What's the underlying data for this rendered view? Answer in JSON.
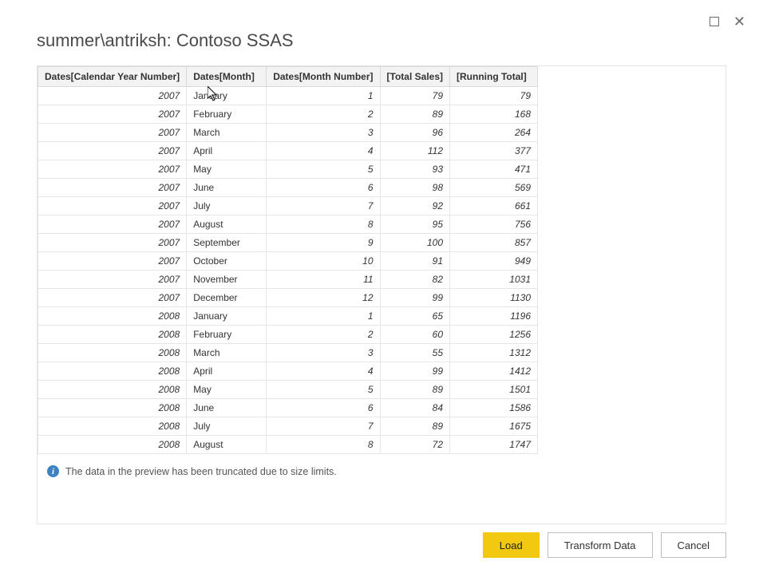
{
  "window": {
    "title": "summer\\antriksh: Contoso SSAS"
  },
  "table": {
    "headers": {
      "year": "Dates[Calendar Year Number]",
      "month": "Dates[Month]",
      "monthnum": "Dates[Month Number]",
      "total": "[Total Sales]",
      "running": "[Running Total]"
    },
    "rows": [
      {
        "year": "2007",
        "month": "January",
        "monthnum": "1",
        "total": "79",
        "running": "79"
      },
      {
        "year": "2007",
        "month": "February",
        "monthnum": "2",
        "total": "89",
        "running": "168"
      },
      {
        "year": "2007",
        "month": "March",
        "monthnum": "3",
        "total": "96",
        "running": "264"
      },
      {
        "year": "2007",
        "month": "April",
        "monthnum": "4",
        "total": "112",
        "running": "377"
      },
      {
        "year": "2007",
        "month": "May",
        "monthnum": "5",
        "total": "93",
        "running": "471"
      },
      {
        "year": "2007",
        "month": "June",
        "monthnum": "6",
        "total": "98",
        "running": "569"
      },
      {
        "year": "2007",
        "month": "July",
        "monthnum": "7",
        "total": "92",
        "running": "661"
      },
      {
        "year": "2007",
        "month": "August",
        "monthnum": "8",
        "total": "95",
        "running": "756"
      },
      {
        "year": "2007",
        "month": "September",
        "monthnum": "9",
        "total": "100",
        "running": "857"
      },
      {
        "year": "2007",
        "month": "October",
        "monthnum": "10",
        "total": "91",
        "running": "949"
      },
      {
        "year": "2007",
        "month": "November",
        "monthnum": "11",
        "total": "82",
        "running": "1031"
      },
      {
        "year": "2007",
        "month": "December",
        "monthnum": "12",
        "total": "99",
        "running": "1130"
      },
      {
        "year": "2008",
        "month": "January",
        "monthnum": "1",
        "total": "65",
        "running": "1196"
      },
      {
        "year": "2008",
        "month": "February",
        "monthnum": "2",
        "total": "60",
        "running": "1256"
      },
      {
        "year": "2008",
        "month": "March",
        "monthnum": "3",
        "total": "55",
        "running": "1312"
      },
      {
        "year": "2008",
        "month": "April",
        "monthnum": "4",
        "total": "99",
        "running": "1412"
      },
      {
        "year": "2008",
        "month": "May",
        "monthnum": "5",
        "total": "89",
        "running": "1501"
      },
      {
        "year": "2008",
        "month": "June",
        "monthnum": "6",
        "total": "84",
        "running": "1586"
      },
      {
        "year": "2008",
        "month": "July",
        "monthnum": "7",
        "total": "89",
        "running": "1675"
      },
      {
        "year": "2008",
        "month": "August",
        "monthnum": "8",
        "total": "72",
        "running": "1747"
      }
    ]
  },
  "info": {
    "message": "The data in the preview has been truncated due to size limits."
  },
  "buttons": {
    "load": "Load",
    "transform": "Transform Data",
    "cancel": "Cancel"
  }
}
